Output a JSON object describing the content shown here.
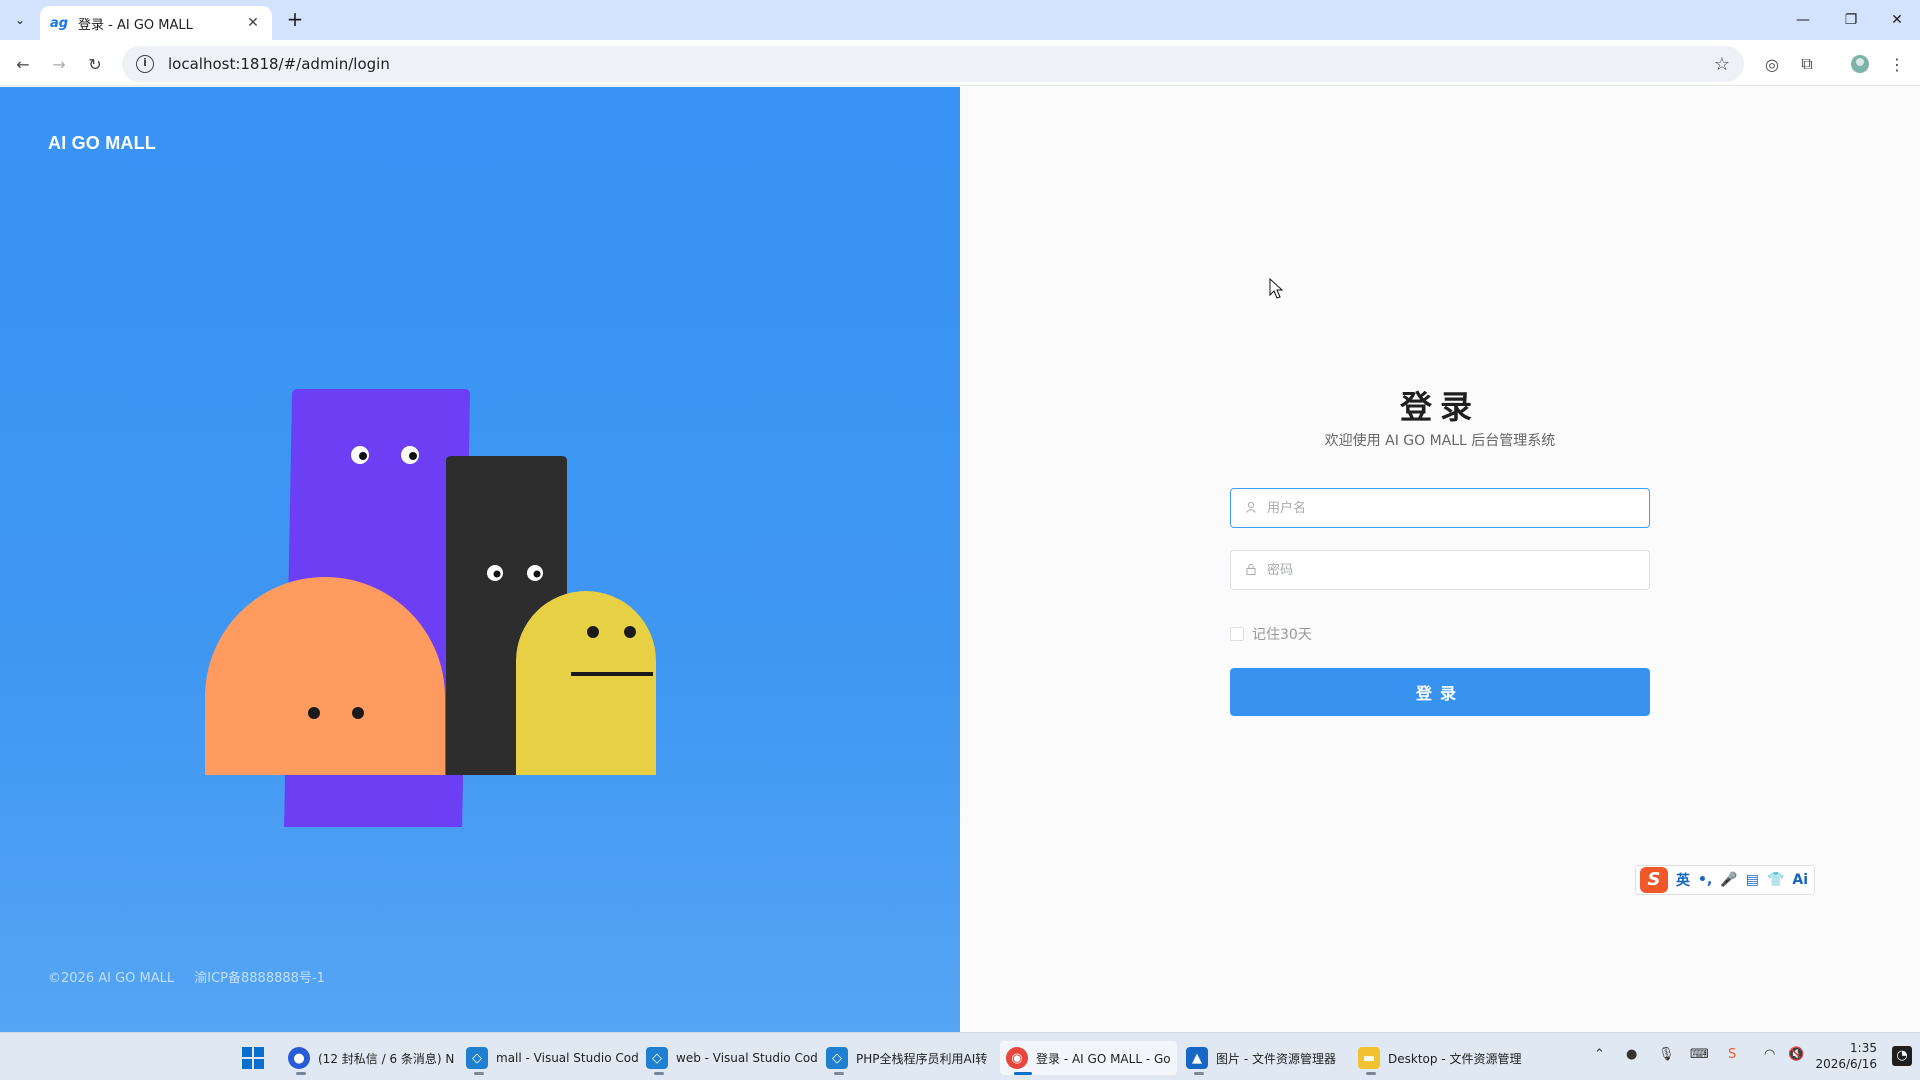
{
  "browser": {
    "tab_title": "登录 - AI GO MALL",
    "tab_favicon": "ag",
    "url": "localhost:1818/#/admin/login"
  },
  "page": {
    "brand": "AI GO MALL",
    "footer_copyright": "©2026 AI GO MALL",
    "footer_icp": "渝ICP备8888888号-1",
    "login": {
      "title": "登录",
      "subtitle": "欢迎使用 AI GO MALL 后台管理系统",
      "username_placeholder": "用户名",
      "password_placeholder": "密码",
      "remember_label": "记住30天",
      "submit_label": "登录"
    },
    "ime_bar": {
      "logo": "S",
      "items": [
        "英",
        "•,",
        "🎤",
        "▤",
        "👕",
        "Ai"
      ]
    }
  },
  "taskbar": {
    "items": [
      {
        "label": "(12 封私信 / 6 条消息) N",
        "icon": "circle-app-icon",
        "color": "#2a5bd7"
      },
      {
        "label": "mall - Visual Studio Cod",
        "icon": "vscode-icon",
        "color": "#1f7fd0"
      },
      {
        "label": "web - Visual Studio Cod",
        "icon": "vscode-icon",
        "color": "#1f7fd0"
      },
      {
        "label": "PHP全栈程序员利用AI转",
        "icon": "vscode-icon",
        "color": "#1f7fd0"
      },
      {
        "label": "登录 - AI GO MALL - Go",
        "icon": "chrome-icon",
        "color": "#e8453c"
      },
      {
        "label": "图片 - 文件资源管理器",
        "icon": "photos-icon",
        "color": "#1768c6"
      },
      {
        "label": "Desktop - 文件资源管理",
        "icon": "folder-icon",
        "color": "#f2c230"
      }
    ],
    "time": "1:35",
    "date": "2026/6/16"
  },
  "colors": {
    "left_panel": "#3893f5",
    "login_button": "#3893f0",
    "purple_character": "#6c3ff5",
    "black_character": "#2d2d2d",
    "orange_character": "#ff9b5e",
    "yellow_character": "#e8d044"
  }
}
